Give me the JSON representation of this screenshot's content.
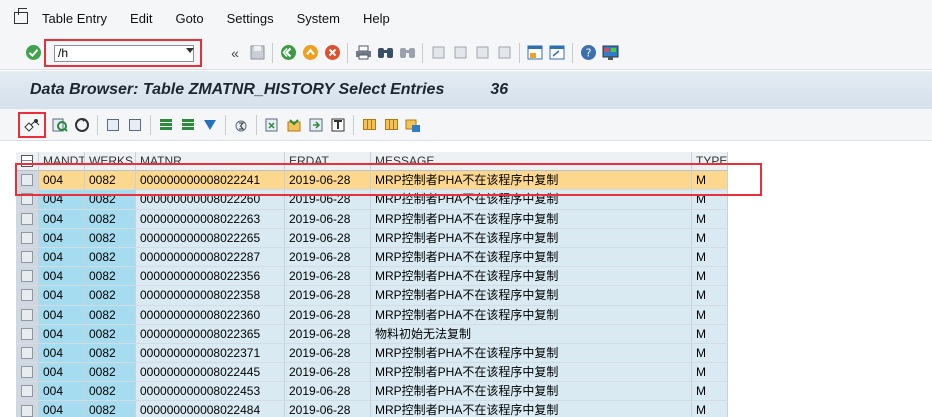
{
  "menu": [
    {
      "label": "Table Entry"
    },
    {
      "label": "Edit"
    },
    {
      "label": "Goto"
    },
    {
      "label": "Settings"
    },
    {
      "label": "System"
    },
    {
      "label": "Help"
    }
  ],
  "command_field": {
    "value": "/h"
  },
  "title": {
    "text": "Data Browser: Table ZMATNR_HISTORY Select Entries",
    "count": "36"
  },
  "table": {
    "columns": [
      "MANDT",
      "WERKS",
      "MATNR",
      "ERDAT",
      "MESSAGE",
      "TYPE"
    ],
    "rows": [
      {
        "mandt": "004",
        "werks": "0082",
        "matnr": "000000000008022241",
        "erdat": "2019-06-28",
        "message": "MRP控制者PHA不在该程序中复制",
        "type": "M"
      },
      {
        "mandt": "004",
        "werks": "0082",
        "matnr": "000000000008022260",
        "erdat": "2019-06-28",
        "message": "MRP控制者PHA不在该程序中复制",
        "type": "M"
      },
      {
        "mandt": "004",
        "werks": "0082",
        "matnr": "000000000008022263",
        "erdat": "2019-06-28",
        "message": "MRP控制者PHA不在该程序中复制",
        "type": "M"
      },
      {
        "mandt": "004",
        "werks": "0082",
        "matnr": "000000000008022265",
        "erdat": "2019-06-28",
        "message": "MRP控制者PHA不在该程序中复制",
        "type": "M"
      },
      {
        "mandt": "004",
        "werks": "0082",
        "matnr": "000000000008022287",
        "erdat": "2019-06-28",
        "message": "MRP控制者PHA不在该程序中复制",
        "type": "M"
      },
      {
        "mandt": "004",
        "werks": "0082",
        "matnr": "000000000008022356",
        "erdat": "2019-06-28",
        "message": "MRP控制者PHA不在该程序中复制",
        "type": "M"
      },
      {
        "mandt": "004",
        "werks": "0082",
        "matnr": "000000000008022358",
        "erdat": "2019-06-28",
        "message": "MRP控制者PHA不在该程序中复制",
        "type": "M"
      },
      {
        "mandt": "004",
        "werks": "0082",
        "matnr": "000000000008022360",
        "erdat": "2019-06-28",
        "message": "MRP控制者PHA不在该程序中复制",
        "type": "M"
      },
      {
        "mandt": "004",
        "werks": "0082",
        "matnr": "000000000008022365",
        "erdat": "2019-06-28",
        "message": "物料初始无法复制",
        "type": "M"
      },
      {
        "mandt": "004",
        "werks": "0082",
        "matnr": "000000000008022371",
        "erdat": "2019-06-28",
        "message": "MRP控制者PHA不在该程序中复制",
        "type": "M"
      },
      {
        "mandt": "004",
        "werks": "0082",
        "matnr": "000000000008022445",
        "erdat": "2019-06-28",
        "message": "MRP控制者PHA不在该程序中复制",
        "type": "M"
      },
      {
        "mandt": "004",
        "werks": "0082",
        "matnr": "000000000008022453",
        "erdat": "2019-06-28",
        "message": "MRP控制者PHA不在该程序中复制",
        "type": "M"
      },
      {
        "mandt": "004",
        "werks": "0082",
        "matnr": "000000000008022484",
        "erdat": "2019-06-28",
        "message": "MRP控制者PHA不在该程序中复制",
        "type": "M"
      }
    ]
  },
  "colors": {
    "accent_red": "#e8303a",
    "selected_row": "#fcd88f",
    "key_column": "#a6dcef",
    "data_column": "#d9eaf3"
  },
  "icons": [
    "app-menu-icon",
    "enter-check-icon",
    "save-icon",
    "back-icon",
    "exit-icon",
    "cancel-icon",
    "print-icon",
    "find-icon",
    "find-next-icon",
    "first-page-icon",
    "previous-page-icon",
    "next-page-icon",
    "last-page-icon",
    "new-session-icon",
    "shortcut-icon",
    "help-icon",
    "customize-layout-icon",
    "check-table-icon",
    "details-icon",
    "refresh-icon",
    "select-all-icon",
    "deselect-all-icon",
    "sort-ascending-icon",
    "sort-descending-icon",
    "filter-icon",
    "sum-icon",
    "export-icon",
    "change-layout-icon",
    "choose-layout-icon",
    "print-preview-icon",
    "spreadsheet-icon",
    "word-processing-icon",
    "local-file-icon"
  ]
}
